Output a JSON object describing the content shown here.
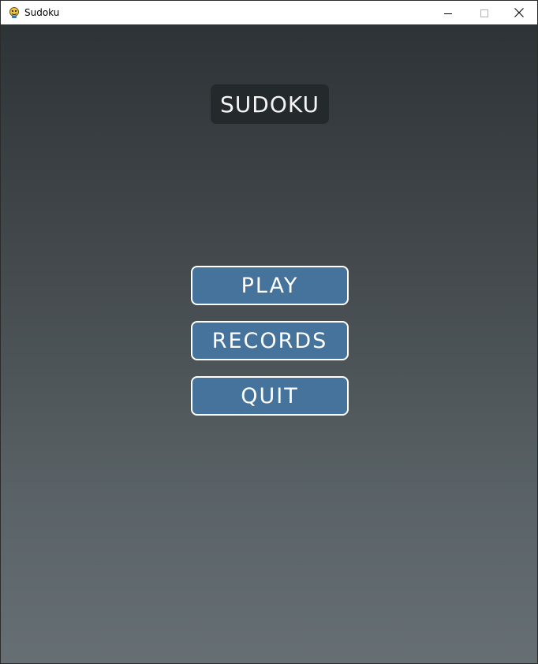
{
  "window": {
    "title": "Sudoku",
    "icon": "python-snake-icon",
    "controls": {
      "minimize": "minimize-icon",
      "maximize": "maximize-icon",
      "close": "close-icon"
    }
  },
  "game": {
    "title": "SUDOKU"
  },
  "menu": {
    "play_label": "PLAY",
    "records_label": "RECORDS",
    "quit_label": "QUIT"
  },
  "colors": {
    "button_fill": "#45739c",
    "button_border": "#ffffff",
    "title_bg": "#24292b",
    "background_top": "#2d3336",
    "background_bottom": "#666f74"
  }
}
